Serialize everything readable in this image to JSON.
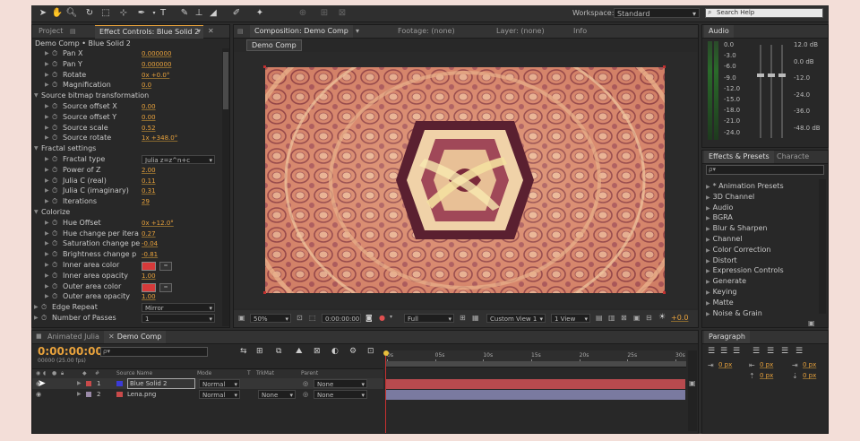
{
  "toolbar": {
    "workspace_label": "Workspace:",
    "workspace_value": "Standard",
    "search_placeholder": "Search Help"
  },
  "project_panel": {
    "tab_project": "Project",
    "tab_effect_controls": "Effect Controls: Blue Solid 2",
    "breadcrumb": "Demo Comp • Blue Solid 2",
    "rows": [
      {
        "type": "prop",
        "indent": 2,
        "label": "Pan X",
        "value": "0.000000"
      },
      {
        "type": "prop",
        "indent": 2,
        "label": "Pan Y",
        "value": "0.000000"
      },
      {
        "type": "prop",
        "indent": 2,
        "label": "Rotate",
        "value": "0x +0.0°"
      },
      {
        "type": "prop",
        "indent": 2,
        "label": "Magnification",
        "value": "0.0"
      },
      {
        "type": "group",
        "indent": 1,
        "label": "Source bitmap transformation"
      },
      {
        "type": "prop",
        "indent": 2,
        "label": "Source offset X",
        "value": "0.00"
      },
      {
        "type": "prop",
        "indent": 2,
        "label": "Source offset Y",
        "value": "0.00"
      },
      {
        "type": "prop",
        "indent": 2,
        "label": "Source scale",
        "value": "0.52"
      },
      {
        "type": "prop",
        "indent": 2,
        "label": "Source rotate",
        "value": "1x +348.0°"
      },
      {
        "type": "group",
        "indent": 1,
        "label": "Fractal settings"
      },
      {
        "type": "dropdown",
        "indent": 2,
        "label": "Fractal type",
        "value": "Julia z=z^n+c"
      },
      {
        "type": "prop",
        "indent": 2,
        "label": "Power of Z",
        "value": "2.00"
      },
      {
        "type": "prop",
        "indent": 2,
        "label": "Julia C (real)",
        "value": "0.11"
      },
      {
        "type": "prop",
        "indent": 2,
        "label": "Julia C (imaginary)",
        "value": "0.31"
      },
      {
        "type": "prop",
        "indent": 2,
        "label": "Iterations",
        "value": "29"
      },
      {
        "type": "group",
        "indent": 1,
        "label": "Colorize"
      },
      {
        "type": "prop",
        "indent": 2,
        "label": "Hue Offset",
        "value": "0x +12.0°"
      },
      {
        "type": "prop",
        "indent": 2,
        "label": "Hue change per itera",
        "value": "0.27"
      },
      {
        "type": "prop",
        "indent": 2,
        "label": "Saturation change pe",
        "value": "-0.04"
      },
      {
        "type": "prop",
        "indent": 2,
        "label": "Brightness change p",
        "value": "-0.81"
      },
      {
        "type": "color",
        "indent": 2,
        "label": "Inner area color",
        "value": ""
      },
      {
        "type": "prop",
        "indent": 2,
        "label": "Inner area opacity",
        "value": "1.00"
      },
      {
        "type": "color",
        "indent": 2,
        "label": "Outer area color",
        "value": ""
      },
      {
        "type": "prop",
        "indent": 2,
        "label": "Outer area opacity",
        "value": "1.00"
      },
      {
        "type": "dropdown",
        "indent": 1,
        "label": "Edge Repeat",
        "value": "Mirror"
      },
      {
        "type": "dropdown",
        "indent": 1,
        "label": "Number of Passes",
        "value": "1"
      }
    ]
  },
  "composition": {
    "tab_comp": "Composition: Demo Comp",
    "tab_footage": "Footage: (none)",
    "tab_layer": "Layer: (none)",
    "tab_info": "Info",
    "breadcrumb": "Demo Comp",
    "zoom": "50%",
    "timecode": "0:00:00:00",
    "resolution": "Full",
    "view": "Custom View 1",
    "views": "1 View",
    "exposure": "+0.0"
  },
  "audio": {
    "tab": "Audio",
    "left_scale": [
      "0.0",
      "-3.0",
      "-6.0",
      "-9.0",
      "-12.0",
      "-15.0",
      "-18.0",
      "-21.0",
      "-24.0"
    ],
    "right_scale": [
      "12.0 dB",
      "0.0 dB",
      "-12.0",
      "-24.0",
      "-36.0",
      "-48.0 dB"
    ]
  },
  "effects_presets": {
    "tab": "Effects & Presets",
    "tab2": "Characte",
    "search_placeholder": "ρ▾",
    "items": [
      "* Animation Presets",
      "3D Channel",
      "Audio",
      "BGRA",
      "Blur & Sharpen",
      "Channel",
      "Color Correction",
      "Distort",
      "Expression Controls",
      "Generate",
      "Keying",
      "Matte",
      "Noise & Grain"
    ]
  },
  "timeline": {
    "tab_animated": "Animated Julia",
    "tab_demo": "Demo Comp",
    "timecode": "0:00:00:00",
    "fps": "00000 (25.00 fps)",
    "search_placeholder": "ρ▾",
    "col_source": "Source Name",
    "col_mode": "Mode",
    "col_t": "T",
    "col_trkmat": "TrkMat",
    "col_parent": "Parent",
    "ruler": [
      "0s",
      "05s",
      "10s",
      "15s",
      "20s",
      "25s",
      "30s"
    ],
    "layers": [
      {
        "num": "1",
        "name": "Blue Solid 2",
        "mode": "Normal",
        "trkmat": "",
        "parent": "None",
        "color": "#3b3bd6"
      },
      {
        "num": "2",
        "name": "Lena.png",
        "mode": "Normal",
        "trkmat": "None",
        "parent": "None",
        "color": "#c84a4a"
      }
    ]
  },
  "paragraph": {
    "tab": "Paragraph",
    "values": [
      "0 px",
      "0 px",
      "0 px",
      "0 px",
      "0 px"
    ]
  }
}
